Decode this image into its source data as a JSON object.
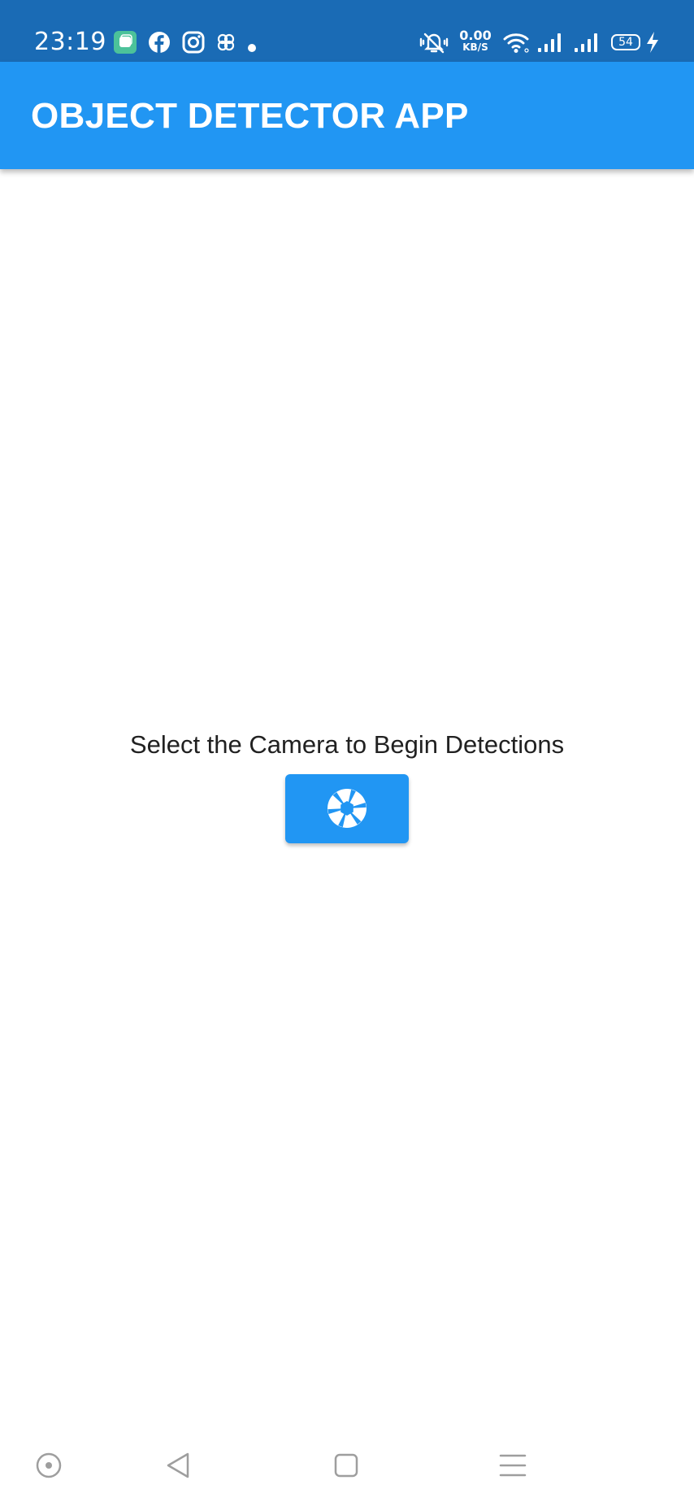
{
  "status_bar": {
    "time": "23:19",
    "left_icons": [
      "chat-app-icon",
      "facebook-icon",
      "instagram-icon",
      "vpn-icon",
      "dot-icon"
    ],
    "right_icons": [
      "vibrate-icon",
      "wifi-icon",
      "signal-icon",
      "signal-icon",
      "charging-icon"
    ],
    "net_speed_value": "0.00",
    "net_speed_unit": "KB/S",
    "battery_level": "54",
    "bg_color": "#1a6bb5"
  },
  "app_bar": {
    "title": "OBJECT DETECTOR APP",
    "bg_color": "#2196f3"
  },
  "main": {
    "prompt": "Select the Camera to Begin Detections",
    "camera_button_icon": "camera-shutter-icon",
    "button_color": "#2196f3"
  },
  "nav_bar": {
    "items": [
      "home-circle-icon",
      "back-icon",
      "recents-icon",
      "menu-icon"
    ]
  }
}
